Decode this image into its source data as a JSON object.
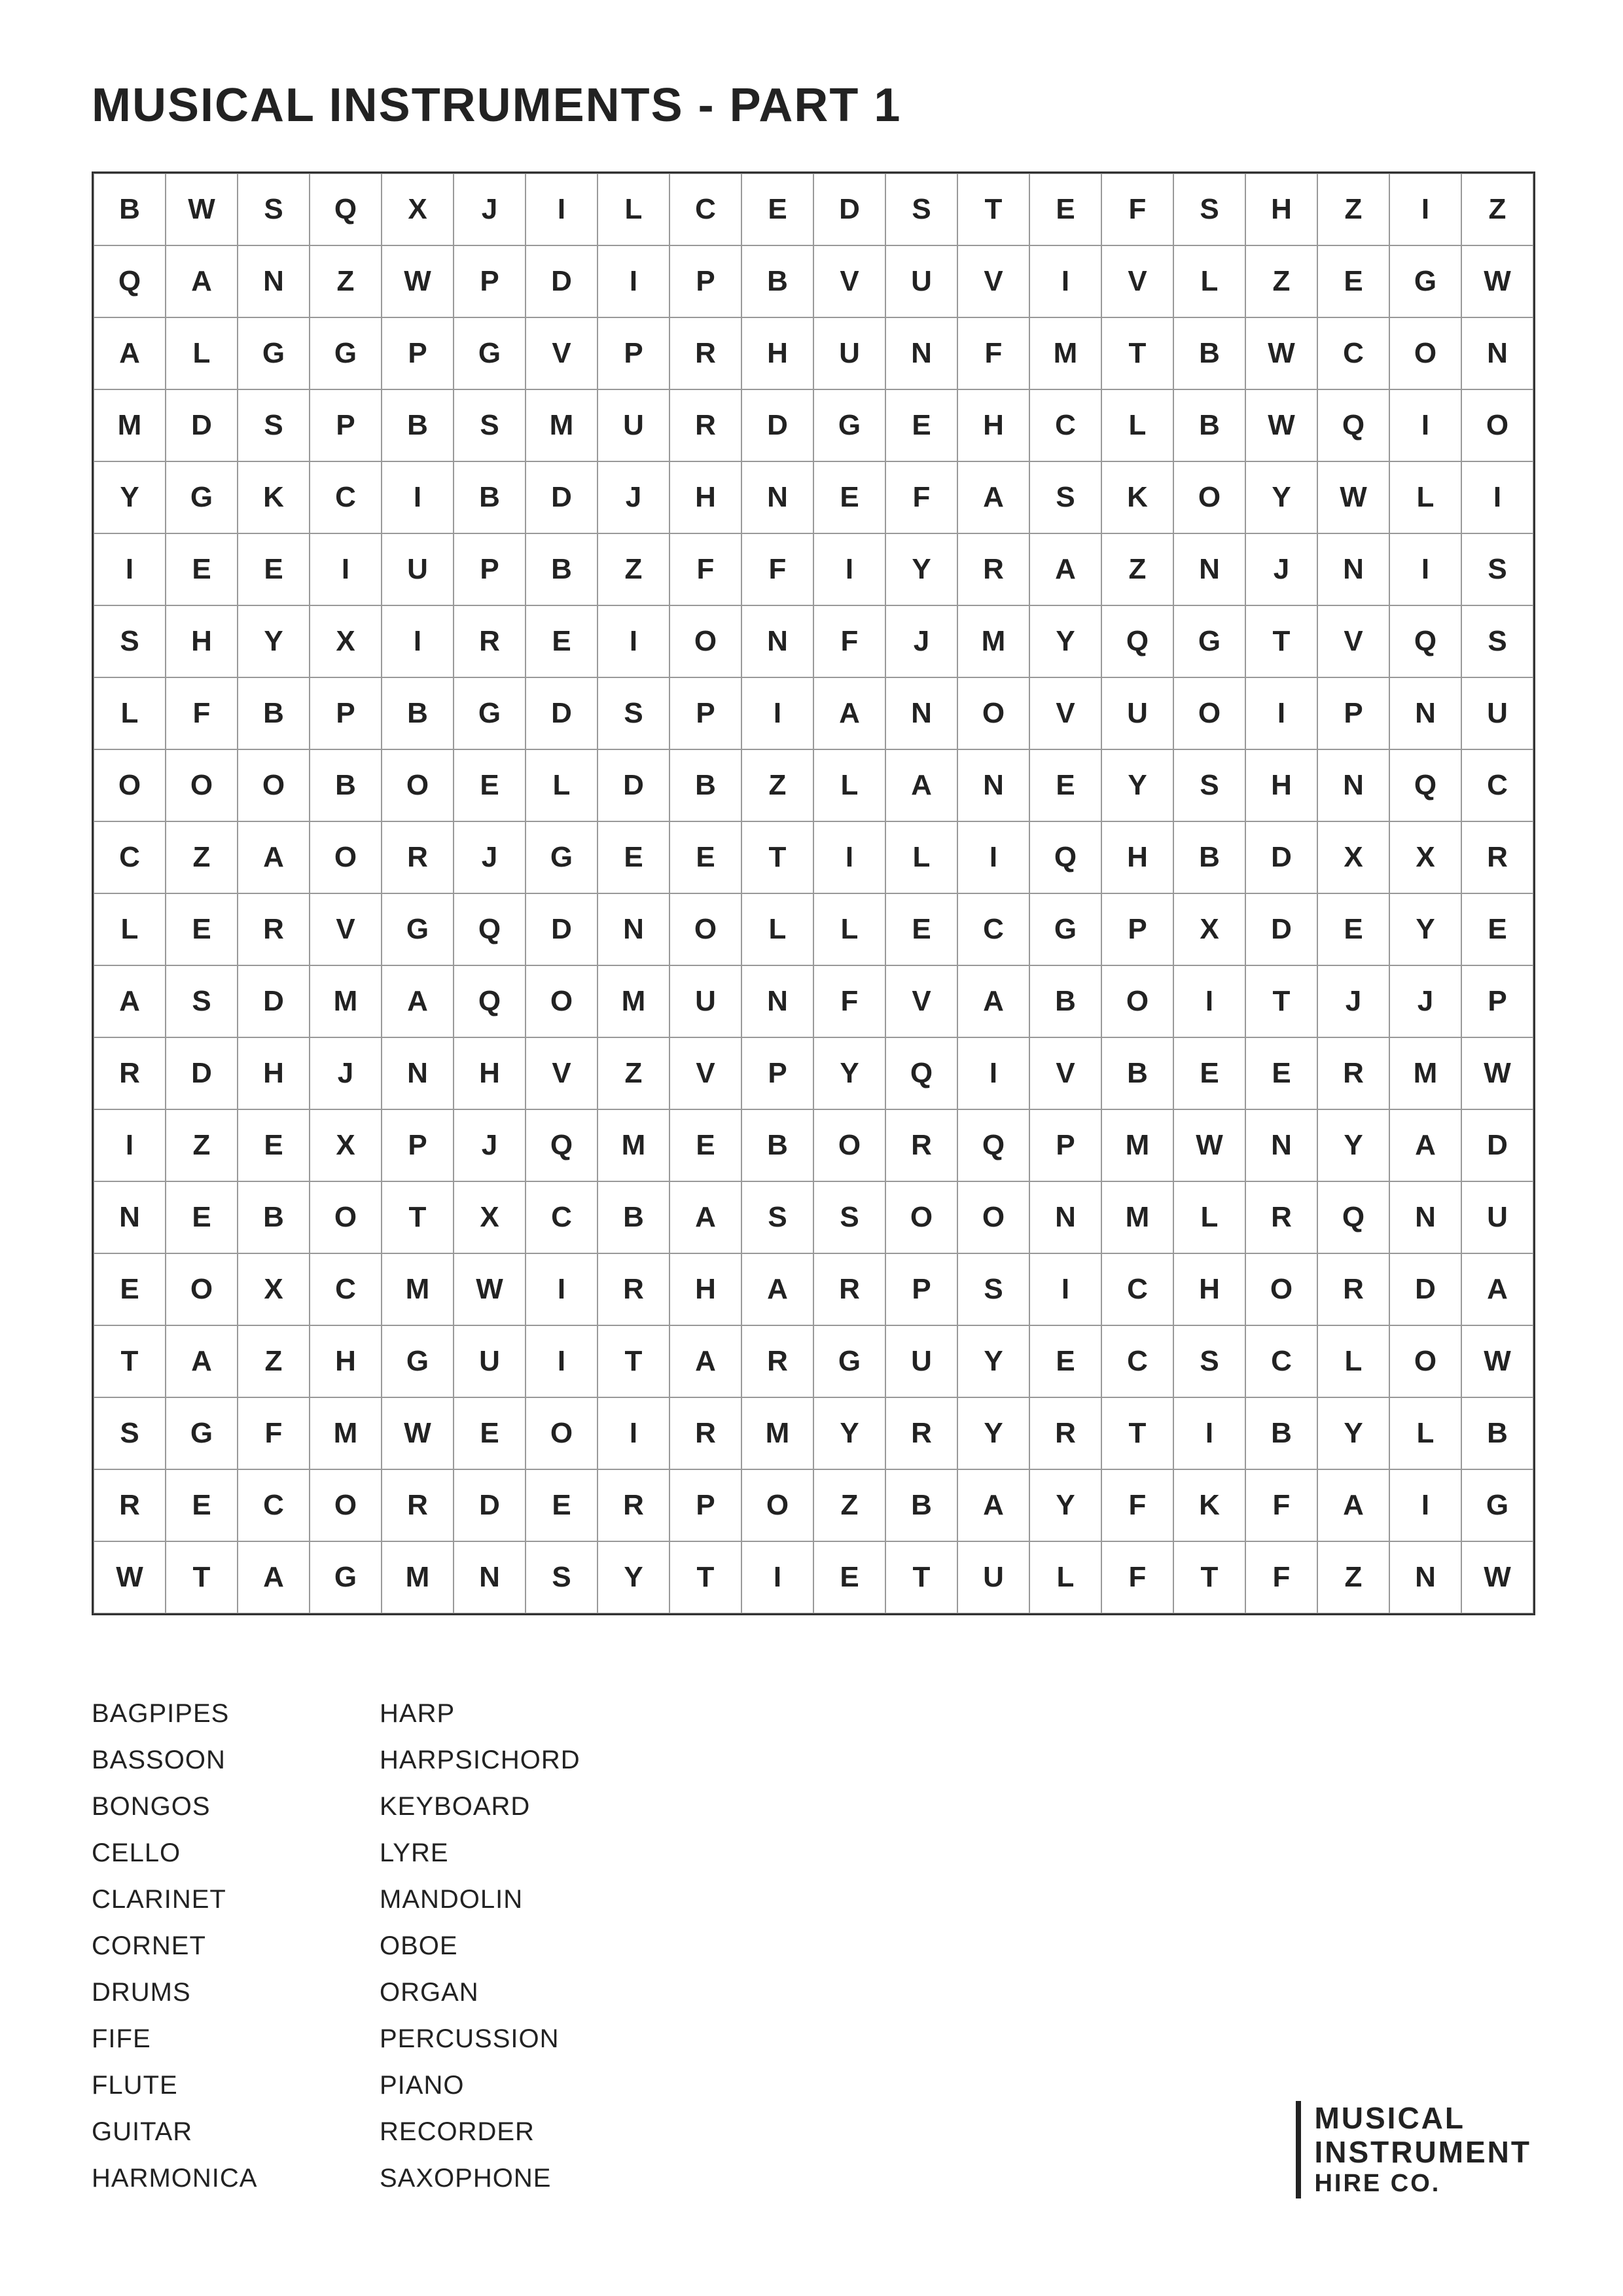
{
  "title": "MUSICAL INSTRUMENTS - PART 1",
  "grid": [
    [
      "B",
      "W",
      "S",
      "Q",
      "X",
      "J",
      "I",
      "L",
      "C",
      "E",
      "D",
      "S",
      "T",
      "E",
      "F",
      "S",
      "H",
      "Z",
      "I",
      "Z"
    ],
    [
      "Q",
      "A",
      "N",
      "Z",
      "W",
      "P",
      "D",
      "I",
      "P",
      "B",
      "V",
      "U",
      "V",
      "I",
      "V",
      "L",
      "Z",
      "E",
      "G",
      "W"
    ],
    [
      "A",
      "L",
      "G",
      "G",
      "P",
      "G",
      "V",
      "P",
      "R",
      "H",
      "U",
      "N",
      "F",
      "M",
      "T",
      "B",
      "W",
      "C",
      "O",
      "N"
    ],
    [
      "M",
      "D",
      "S",
      "P",
      "B",
      "S",
      "M",
      "U",
      "R",
      "D",
      "G",
      "E",
      "H",
      "C",
      "L",
      "B",
      "W",
      "Q",
      "I",
      "O"
    ],
    [
      "Y",
      "G",
      "K",
      "C",
      "I",
      "B",
      "D",
      "J",
      "H",
      "N",
      "E",
      "F",
      "A",
      "S",
      "K",
      "O",
      "Y",
      "W",
      "L",
      "I"
    ],
    [
      "I",
      "E",
      "E",
      "I",
      "U",
      "P",
      "B",
      "Z",
      "F",
      "F",
      "I",
      "Y",
      "R",
      "A",
      "Z",
      "N",
      "J",
      "N",
      "I",
      "S"
    ],
    [
      "S",
      "H",
      "Y",
      "X",
      "I",
      "R",
      "E",
      "I",
      "O",
      "N",
      "F",
      "J",
      "M",
      "Y",
      "Q",
      "G",
      "T",
      "V",
      "Q",
      "S"
    ],
    [
      "L",
      "F",
      "B",
      "P",
      "B",
      "G",
      "D",
      "S",
      "P",
      "I",
      "A",
      "N",
      "O",
      "V",
      "U",
      "O",
      "I",
      "P",
      "N",
      "U"
    ],
    [
      "O",
      "O",
      "O",
      "B",
      "O",
      "E",
      "L",
      "D",
      "B",
      "Z",
      "L",
      "A",
      "N",
      "E",
      "Y",
      "S",
      "H",
      "N",
      "Q",
      "C"
    ],
    [
      "C",
      "Z",
      "A",
      "O",
      "R",
      "J",
      "G",
      "E",
      "E",
      "T",
      "I",
      "L",
      "I",
      "Q",
      "H",
      "B",
      "D",
      "X",
      "X",
      "R"
    ],
    [
      "L",
      "E",
      "R",
      "V",
      "G",
      "Q",
      "D",
      "N",
      "O",
      "L",
      "L",
      "E",
      "C",
      "G",
      "P",
      "X",
      "D",
      "E",
      "Y",
      "E"
    ],
    [
      "A",
      "S",
      "D",
      "M",
      "A",
      "Q",
      "O",
      "M",
      "U",
      "N",
      "F",
      "V",
      "A",
      "B",
      "O",
      "I",
      "T",
      "J",
      "J",
      "P"
    ],
    [
      "R",
      "D",
      "H",
      "J",
      "N",
      "H",
      "V",
      "Z",
      "V",
      "P",
      "Y",
      "Q",
      "I",
      "V",
      "B",
      "E",
      "E",
      "R",
      "M",
      "W"
    ],
    [
      "I",
      "Z",
      "E",
      "X",
      "P",
      "J",
      "Q",
      "M",
      "E",
      "B",
      "O",
      "R",
      "Q",
      "P",
      "M",
      "W",
      "N",
      "Y",
      "A",
      "D"
    ],
    [
      "N",
      "E",
      "B",
      "O",
      "T",
      "X",
      "C",
      "B",
      "A",
      "S",
      "S",
      "O",
      "O",
      "N",
      "M",
      "L",
      "R",
      "Q",
      "N",
      "U"
    ],
    [
      "E",
      "O",
      "X",
      "C",
      "M",
      "W",
      "I",
      "R",
      "H",
      "A",
      "R",
      "P",
      "S",
      "I",
      "C",
      "H",
      "O",
      "R",
      "D",
      "A"
    ],
    [
      "T",
      "A",
      "Z",
      "H",
      "G",
      "U",
      "I",
      "T",
      "A",
      "R",
      "G",
      "U",
      "Y",
      "E",
      "C",
      "S",
      "C",
      "L",
      "O",
      "W"
    ],
    [
      "S",
      "G",
      "F",
      "M",
      "W",
      "E",
      "O",
      "I",
      "R",
      "M",
      "Y",
      "R",
      "Y",
      "R",
      "T",
      "I",
      "B",
      "Y",
      "L",
      "B"
    ],
    [
      "R",
      "E",
      "C",
      "O",
      "R",
      "D",
      "E",
      "R",
      "P",
      "O",
      "Z",
      "B",
      "A",
      "Y",
      "F",
      "K",
      "F",
      "A",
      "I",
      "G"
    ],
    [
      "W",
      "T",
      "A",
      "G",
      "M",
      "N",
      "S",
      "Y",
      "T",
      "I",
      "E",
      "T",
      "U",
      "L",
      "F",
      "T",
      "F",
      "Z",
      "N",
      "W"
    ]
  ],
  "words_col1": [
    "BAGPIPES",
    "BASSOON",
    "BONGOS",
    "CELLO",
    "CLARINET",
    "CORNET",
    "DRUMS",
    "FIFE",
    "FLUTE",
    "GUITAR",
    "HARMONICA"
  ],
  "words_col2": [
    "HARP",
    "HARPSICHORD",
    "KEYBOARD",
    "LYRE",
    "MANDOLIN",
    "OBOE",
    "ORGAN",
    "PERCUSSION",
    "PIANO",
    "RECORDER",
    "SAXOPHONE"
  ],
  "logo": {
    "line1": "MUSICAL",
    "line2": "INSTRUMENT",
    "line3": "HIRE CO."
  }
}
